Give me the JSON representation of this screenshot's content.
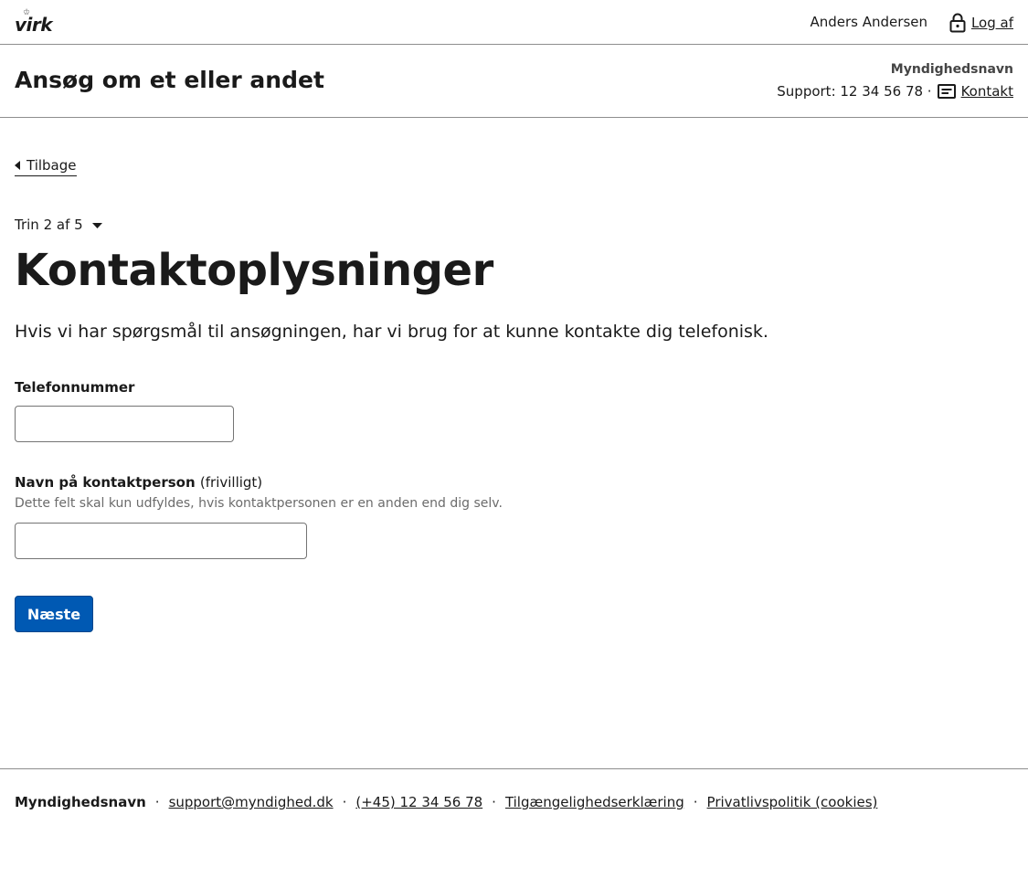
{
  "topbar": {
    "logo_text": "virk",
    "logo_crown": "♔",
    "user_name": "Anders Andersen",
    "logout_label": "Log af"
  },
  "header": {
    "title": "Ansøg om et eller andet",
    "authority": "Myndighedsnavn",
    "support_text": "Support: 12 34 56 78 ·",
    "contact_label": "Kontakt"
  },
  "main": {
    "back_label": "Tilbage",
    "step_label": "Trin 2 af 5",
    "page_title": "Kontaktoplysninger",
    "intro": "Hvis vi har spørgsmål til ansøgningen, har vi brug for at kunne kontakte dig telefonisk.",
    "phone": {
      "label": "Telefonnummer",
      "value": ""
    },
    "contact_person": {
      "label": "Navn på kontaktperson",
      "optional": "(frivilligt)",
      "hint": "Dette felt skal kun udfyldes, hvis kontaktpersonen er en anden end dig selv.",
      "value": ""
    },
    "next_label": "Næste"
  },
  "footer": {
    "authority": "Myndighedsnavn",
    "separator": "·",
    "email": "support@myndighed.dk",
    "phone": "(+45) 12 34 56 78",
    "accessibility": "Tilgængelighedserklæring",
    "privacy": "Privatlivspolitik (cookies)"
  },
  "colors": {
    "primary_button": "#0059b3",
    "text": "#1a1a1a",
    "hint_text": "#6b6b6b",
    "border": "#8e8e8e"
  },
  "icons": [
    "lock-icon",
    "contact-card-icon",
    "caret-left-icon",
    "caret-down-icon"
  ]
}
